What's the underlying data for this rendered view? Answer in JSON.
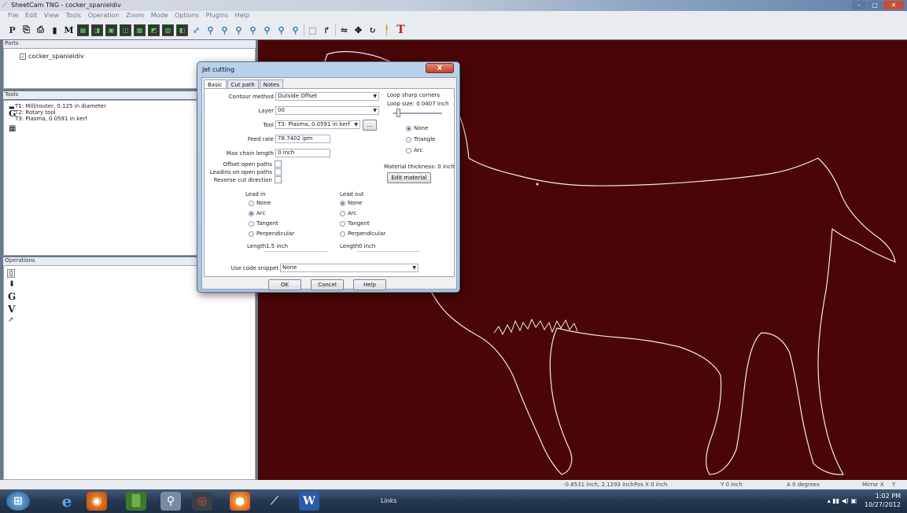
{
  "window": {
    "title": "SheetCam TNG - cocker_spanieldiv",
    "min": "–",
    "max": "□",
    "close": "✕"
  },
  "menu": [
    "File",
    "Edit",
    "View",
    "Tools",
    "Operation",
    "Zoom",
    "Mode",
    "Options",
    "Plugins",
    "Help"
  ],
  "toolbar": {
    "p": "P",
    "m": "M",
    "t": "T",
    "icons": [
      "select-pointer",
      "selection",
      "mirror",
      "move",
      "rotate",
      "pin"
    ]
  },
  "parts": {
    "header": "Parts",
    "items": [
      {
        "label": "cocker_spanieldiv",
        "checked": "✓"
      }
    ]
  },
  "tools": {
    "header": "Tools",
    "items": [
      "T1: Mill/router, 0.125 in diameter",
      "T2: Rotary tool",
      "T3: Plasma, 0.0591 in kerf"
    ],
    "glyph_g": "G"
  },
  "operations": {
    "header": "Operations",
    "glyphs": [
      "G",
      "V"
    ]
  },
  "dialog": {
    "title": "Jet cutting",
    "close": "X",
    "tabs": [
      "Basic",
      "Cut path",
      "Notes"
    ],
    "contour_method_label": "Contour method",
    "contour_method": "Outside Offset",
    "layer_label": "Layer",
    "layer": "00",
    "tool_label": "Tool",
    "tool": "T3: Plasma, 0.0591 in kerf",
    "tool_browse": "...",
    "feed_rate_label": "Feed rate",
    "feed_rate": "78.7402 ipm",
    "max_chain_label": "Max chain length",
    "max_chain": "0 inch",
    "offset_open_label": "Offset open paths",
    "leadins_open_label": "Leadins on open paths",
    "reverse_label": "Reverse cut direction",
    "loop_label": "Loop sharp corners",
    "loop_size": "Loop size: 0.0407 inch",
    "loop_options": [
      "None",
      "Triangle",
      "Arc"
    ],
    "loop_selected": "None",
    "material_thickness": "Material thickness: 0 inch",
    "edit_material": "Edit material",
    "lead_in_label": "Lead in",
    "lead_in_options": [
      "None",
      "Arc",
      "Tangent",
      "Perpendicular"
    ],
    "lead_in_selected": "Arc",
    "lead_in_length_label": "Length",
    "lead_in_length": "1.5 inch",
    "lead_out_label": "Lead out",
    "lead_out_options": [
      "None",
      "Arc",
      "Tangent",
      "Perpendicular"
    ],
    "lead_out_selected": "None",
    "lead_out_length_label": "Length",
    "lead_out_length": "0 inch",
    "snippet_label": "Use code snippet",
    "snippet": "None",
    "ok": "OK",
    "cancel": "Cancel",
    "help": "Help"
  },
  "status": {
    "coords": "-0.8531 inch, 2.1293 inch",
    "pos_x": "Pos X 0 inch",
    "y": "Y 0 inch",
    "a": "A 0 degrees",
    "mirror": "Mirror X",
    "mirror_y": "Y"
  },
  "taskbar": {
    "links": "Links",
    "time": "1:02 PM",
    "date": "10/27/2012",
    "word": "W"
  },
  "colors": {
    "canvas": "#4a0606",
    "outline": "#f0e8e8"
  }
}
